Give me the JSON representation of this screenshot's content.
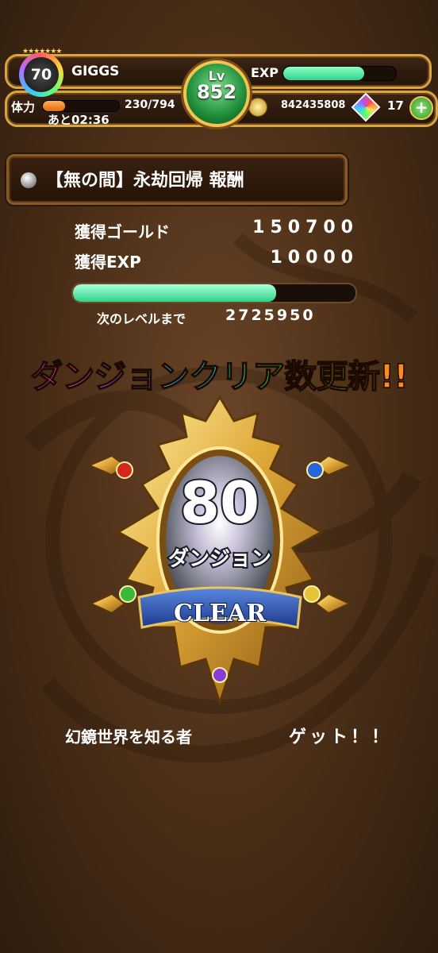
{
  "header": {
    "rank": "70",
    "player_name": "GIGGS",
    "hp_label": "体力",
    "hp_value": "230/794",
    "hp_timer": "あと02:36",
    "hp_fill_fraction": 0.29,
    "level_label": "Lv",
    "level_value": "852",
    "exp_label": "EXP",
    "exp_fill_fraction": 0.72,
    "gold": "842435808",
    "gems": "17",
    "plus_label": "+"
  },
  "title": {
    "text": "【無の間】永劫回帰 報酬"
  },
  "rewards": {
    "gold_label": "獲得ゴールド",
    "gold_value": "150700",
    "exp_label": "獲得EXP",
    "exp_value": "10000",
    "next_label": "次のレベルまで",
    "next_value": "2725950",
    "next_fill_fraction": 0.72
  },
  "banner": {
    "chars": [
      "ダ",
      "ン",
      "ジ",
      "ョ",
      "ン",
      "ク",
      "リ",
      "ア",
      "数",
      "更",
      "新",
      "!!"
    ],
    "colors": [
      "#ff3dbb",
      "#ff3dbb",
      "#b35cff",
      "#7a7dff",
      "#3fb6ff",
      "#2fd8ff",
      "#28e0b0",
      "#3fe07a",
      "#7ee03a",
      "#c8e02a",
      "#ffd21f",
      "#ff8a1f"
    ]
  },
  "medal": {
    "count": "80",
    "subtitle": "ダンジョン",
    "ribbon": "CLEAR"
  },
  "footer": {
    "title_name": "幻鏡世界を知る者",
    "got": "ゲット！！"
  }
}
